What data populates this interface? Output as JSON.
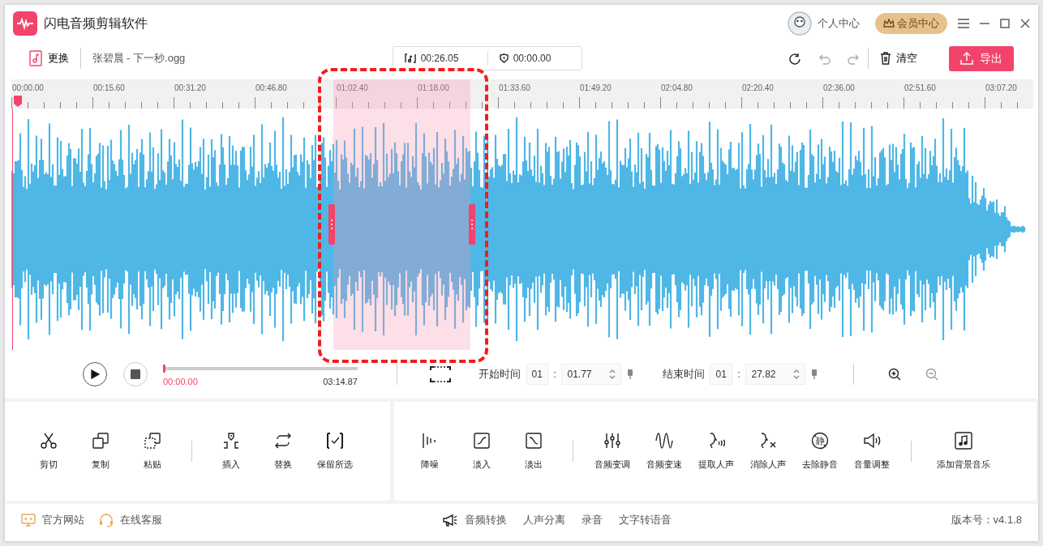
{
  "app": {
    "title": "闪电音频剪辑软件"
  },
  "header_links": [
    {
      "label": "个人中心",
      "kind": "user"
    },
    {
      "label": "会员中心",
      "kind": "vip"
    }
  ],
  "file": {
    "replace_label": "更换",
    "name": "张碧晨 - 下一秒.ogg"
  },
  "durations": [
    {
      "kind": "music",
      "value": "00:26.05"
    },
    {
      "kind": "shield",
      "value": "00:00.00"
    }
  ],
  "clear_label": "清空",
  "export_label": "导出",
  "ruler": [
    "00:00.00",
    "00:15.60",
    "00:31.20",
    "00:46.80",
    "01:02.40",
    "01:18.00",
    "01:33.60",
    "01:49.20",
    "02:04.80",
    "02:20.40",
    "02:36.00",
    "02:51.60",
    "03:07.20"
  ],
  "player": {
    "current": "00:00.00",
    "total": "03:14.87",
    "level": 0
  },
  "selection": {
    "start_label": "开始时间",
    "start_min": "01",
    "start_sec": "01.77",
    "end_label": "结束时间",
    "end_min": "01",
    "end_sec": "27.82",
    "separator": ":"
  },
  "tool_groups_left": [
    [
      {
        "label": "剪切",
        "kind": "scissors"
      },
      {
        "label": "复制",
        "kind": "copy"
      },
      {
        "label": "粘贴",
        "kind": "paste"
      }
    ],
    [
      {
        "label": "插入",
        "kind": "insert"
      },
      {
        "label": "替换",
        "kind": "replace"
      },
      {
        "label": "保留所选",
        "kind": "keep"
      }
    ]
  ],
  "tool_groups_right": [
    [
      {
        "label": "降噪",
        "kind": "denoise"
      },
      {
        "label": "淡入",
        "kind": "fadein"
      },
      {
        "label": "淡出",
        "kind": "fadeout"
      }
    ],
    [
      {
        "label": "音频变调",
        "kind": "eq"
      },
      {
        "label": "音频变速",
        "kind": "wave"
      },
      {
        "label": "提取人声",
        "kind": "voice"
      },
      {
        "label": "消除人声",
        "kind": "novoice"
      },
      {
        "label": "去除静音",
        "kind": "silence",
        "glyph": "静"
      },
      {
        "label": "音量调整",
        "kind": "volume"
      }
    ],
    [
      {
        "label": "添加背景音乐",
        "kind": "music"
      }
    ]
  ],
  "footer": {
    "links": [
      {
        "label": "官方网站",
        "kind": "monitor"
      },
      {
        "label": "在线客服",
        "kind": "headset"
      }
    ],
    "center": [
      {
        "label": "音频转换",
        "kind": "megaphone"
      },
      {
        "label": "人声分离",
        "kind": "plain"
      },
      {
        "label": "录音",
        "kind": "plain"
      },
      {
        "label": "文字转语音",
        "kind": "plain"
      }
    ],
    "version": "版本号：v4.1.8"
  }
}
